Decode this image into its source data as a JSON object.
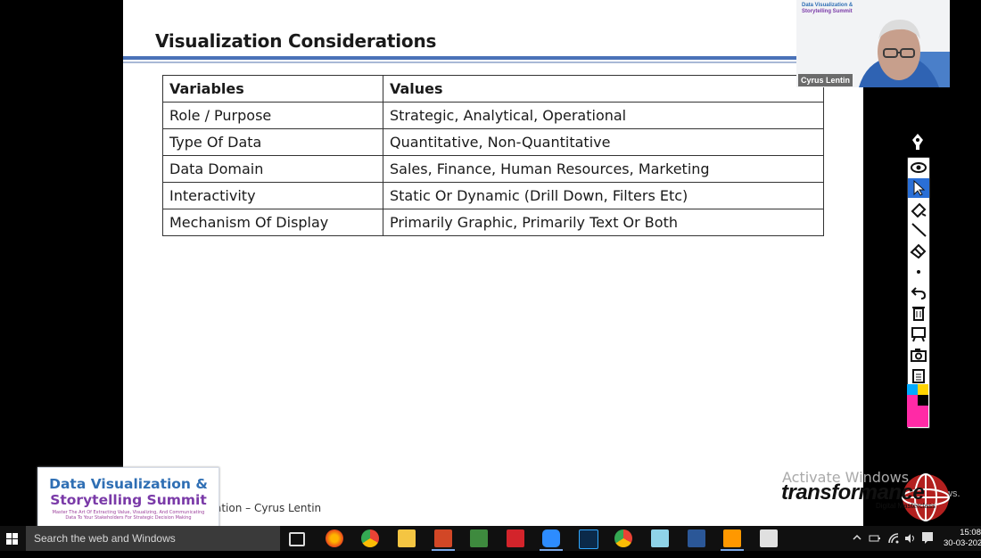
{
  "slide": {
    "title": "Visualization Considerations",
    "table": {
      "headers": [
        "Variables",
        "Values"
      ],
      "rows": [
        [
          "Role / Purpose",
          "Strategic, Analytical, Operational"
        ],
        [
          "Type Of Data",
          "Quantitative, Non-Quantitative"
        ],
        [
          "Data Domain",
          "Sales, Finance, Human Resources, Marketing"
        ],
        [
          "Interactivity",
          "Static Or Dynamic (Drill Down, Filters Etc)"
        ],
        [
          "Mechanism Of Display",
          "Primarily Graphic, Primarily Text Or Both"
        ]
      ]
    },
    "footer": "ation – Cyrus Lentin"
  },
  "summit_logo": {
    "line1": "Data Visualization &",
    "line2": "Storytelling Summit",
    "tagline": "Master The Art Of Extracting Value, Visualizing, And Communicating Data To Your Stakeholders For Strategic Decision Making"
  },
  "webcam": {
    "mini_logo_line1": "Data Visualization &",
    "mini_logo_line2": "Storytelling Summit",
    "participant_name": "Cyrus Lentin"
  },
  "watermark": {
    "activate": "Activate Windows",
    "activate_tail": "ws."
  },
  "transformance_logo": {
    "word": "transformance",
    "subtitle": "Digital Masterclass"
  },
  "annotation_toolbar": {
    "tools": [
      "eye-icon",
      "pointer-icon",
      "highlighter-icon",
      "line-icon",
      "eraser-icon",
      "dot-size-icon",
      "undo-icon",
      "trash-icon",
      "whiteboard-icon",
      "camera-icon",
      "clipboard-icon"
    ],
    "palette_colors": [
      "#00aaff",
      "#ffd400",
      "#ff2aa6",
      "#000000"
    ]
  },
  "taskbar": {
    "search_placeholder": "Search the web and Windows",
    "apps": [
      "task-view-icon",
      "firefox-icon",
      "chrome-icon",
      "file-explorer-icon",
      "powerpoint-icon",
      "excel-icon",
      "acrobat-icon",
      "zoom-icon",
      "photoshop-icon",
      "chrome-icon",
      "notes-icon",
      "word-icon",
      "sublime-icon",
      "media-icon"
    ],
    "time": "15:08",
    "date": "30-03-202"
  }
}
